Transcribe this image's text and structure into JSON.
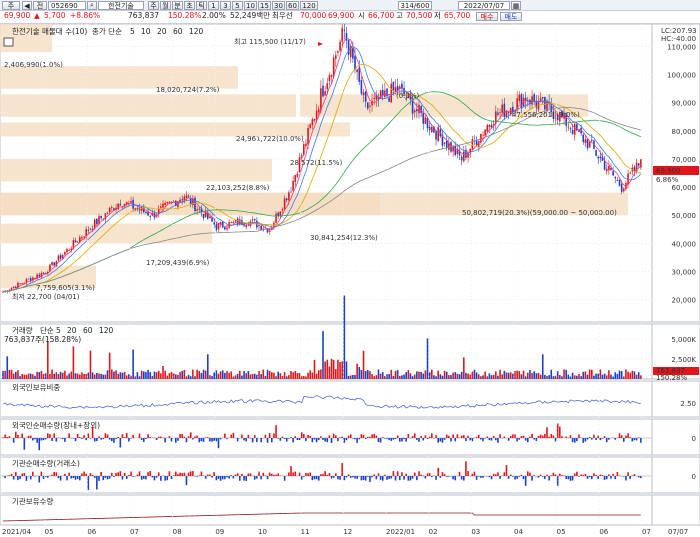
{
  "toolbar": {
    "code": "052690",
    "name": "한전기술",
    "period_buttons": [
      "주",
      "월",
      "분",
      "초",
      "틱",
      "1",
      "3",
      "5",
      "10",
      "15",
      "30",
      "60",
      "120"
    ],
    "counter": "314/600",
    "date": "2022/07/07"
  },
  "quote": {
    "price": "69,900",
    "change": "5,700",
    "change_pct": "+8.86%",
    "volume": "763,837",
    "vol_ratio": "150.28%",
    "turnover": "2.00%",
    "amount": "52,249백만",
    "prev_label": "최우선",
    "prev": "70,000",
    "bid": "69,900",
    "open_label": "시",
    "open": "66,700",
    "high_label": "고",
    "high": "70,500",
    "low_label": "저",
    "low": "65,700",
    "buy_label": "매수",
    "sell_label": "매도"
  },
  "price_panel": {
    "title": "한전기술 매물대 수(10)",
    "ma_label": "종가 단순",
    "ma_periods": [
      "5",
      "10",
      "20",
      "60",
      "120"
    ],
    "ma_colors": [
      "#e8388f",
      "#3a7be0",
      "#e0a800",
      "#2aa84a",
      "#888888"
    ],
    "lc_label": "LC:207.93",
    "hc_label": "HC:-40.00",
    "current_tag": "69,900",
    "current_tag2": "6.86%",
    "high_label": "최고 115,500 (11/17)",
    "low_label": "최저 22,700 (04/01)",
    "y_ticks": [
      "110,000",
      "100,000",
      "90,000",
      "80,000",
      "70,000",
      "60,000",
      "50,000",
      "40,000",
      "30,000",
      "20,000"
    ],
    "volume_profile": [
      {
        "text": "2,406,990(1.0%)"
      },
      {
        "text": "18,020,724(7.2%)"
      },
      {
        "text": "24,961,722(10.0%)"
      },
      {
        "text": "28,572(11.5%)"
      },
      {
        "text": "22,103,252(8.8%)"
      },
      {
        "text": "30,841,254(12.3%)"
      },
      {
        "text": "17,209,439(6.9%)"
      },
      {
        "text": "7,759,605(3.1%)"
      },
      {
        "text": "47,556,201(19.0%)"
      },
      {
        "text": "50,802,719(20.3%)(59,000.00 ~ 50,000.00)"
      },
      {
        "text": "(0.0%)"
      }
    ]
  },
  "volume_panel": {
    "title": "거래량",
    "ma_label": "단순",
    "ma_periods": [
      "5",
      "20",
      "60",
      "120"
    ],
    "sub": "763,837주(158.28%)",
    "y_ticks": [
      "5,000K",
      "2,500K"
    ],
    "tag": "763,837",
    "tag2": "150.28%"
  },
  "foreign_panel": {
    "title": "외국인보유비중",
    "y_tick": "2.50"
  },
  "foreign_net_panel": {
    "title": "외국인순매수량(장내+장외)",
    "y_tick": "0"
  },
  "inst_net_panel": {
    "title": "기관순매수량(거래소)",
    "y_tick": "0"
  },
  "inst_hold_panel": {
    "title": "기관보유수량"
  },
  "x_axis": [
    "2021/04",
    "05",
    "06",
    "07",
    "08",
    "09",
    "10",
    "11",
    "12",
    "2022/01",
    "02",
    "03",
    "04",
    "05",
    "06",
    "07",
    "07/07"
  ],
  "colors": {
    "up": "#e0161b",
    "down": "#1a3fc8",
    "profile": "#f5dcc0"
  }
}
